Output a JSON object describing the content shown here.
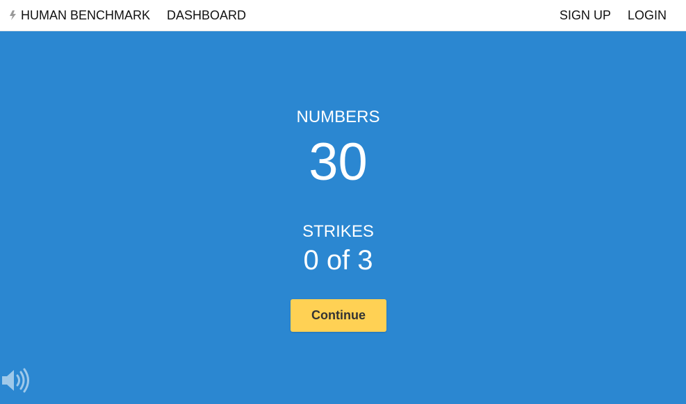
{
  "header": {
    "brand_label": "HUMAN BENCHMARK",
    "dashboard_label": "DASHBOARD",
    "signup_label": "SIGN UP",
    "login_label": "LOGIN",
    "logo_icon": "lightning-bolt-icon"
  },
  "game": {
    "title": "NUMBERS",
    "level": "30",
    "strikes_label": "STRIKES",
    "strikes_value": "0 of 3",
    "continue_label": "Continue"
  },
  "footer": {
    "sound_icon": "speaker-volume-icon"
  },
  "colors": {
    "background": "#2b87d1",
    "button": "#ffd154",
    "topbar": "#ffffff"
  }
}
